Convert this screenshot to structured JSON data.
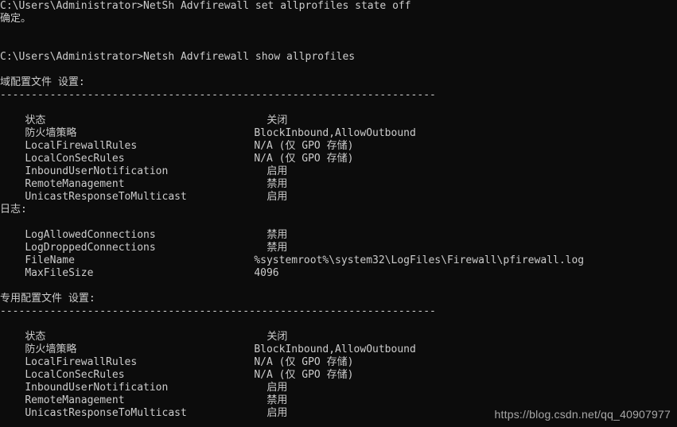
{
  "window": {
    "app": "Command Prompt",
    "background_color": "#0c0c0c",
    "text_color": "#cccccc"
  },
  "terminal": {
    "prompt_1": "C:\\Users\\Administrator>NetSh Advfirewall set allprofiles state off",
    "result_1": "确定。",
    "blank_1": "",
    "blank_2": "",
    "prompt_2": "C:\\Users\\Administrator>Netsh Advfirewall show allprofiles",
    "blank_3": "",
    "sections": [
      {
        "title": "域配置文件 设置:",
        "rule": "----------------------------------------------------------------------",
        "rows": [
          {
            "key": "状态",
            "value": "关闭",
            "cjk": true
          },
          {
            "key": "防火墙策略",
            "value": "BlockInbound,AllowOutbound",
            "cjk": false
          },
          {
            "key": "LocalFirewallRules",
            "value": "N/A (仅 GPO 存储)",
            "cjk": false
          },
          {
            "key": "LocalConSecRules",
            "value": "N/A (仅 GPO 存储)",
            "cjk": false
          },
          {
            "key": "InboundUserNotification",
            "value": "启用",
            "cjk": true
          },
          {
            "key": "RemoteManagement",
            "value": "禁用",
            "cjk": true
          },
          {
            "key": "UnicastResponseToMulticast",
            "value": "启用",
            "cjk": true
          }
        ],
        "sub_title": "日志:",
        "sub_rows": [
          {
            "key": "LogAllowedConnections",
            "value": "禁用",
            "cjk": true
          },
          {
            "key": "LogDroppedConnections",
            "value": "禁用",
            "cjk": true
          },
          {
            "key": "FileName",
            "value": "%systemroot%\\system32\\LogFiles\\Firewall\\pfirewall.log",
            "cjk": false
          },
          {
            "key": "MaxFileSize",
            "value": "4096",
            "cjk": false
          }
        ]
      },
      {
        "title": "专用配置文件 设置:",
        "rule": "----------------------------------------------------------------------",
        "rows": [
          {
            "key": "状态",
            "value": "关闭",
            "cjk": true
          },
          {
            "key": "防火墙策略",
            "value": "BlockInbound,AllowOutbound",
            "cjk": false
          },
          {
            "key": "LocalFirewallRules",
            "value": "N/A (仅 GPO 存储)",
            "cjk": false
          },
          {
            "key": "LocalConSecRules",
            "value": "N/A (仅 GPO 存储)",
            "cjk": false
          },
          {
            "key": "InboundUserNotification",
            "value": "启用",
            "cjk": true
          },
          {
            "key": "RemoteManagement",
            "value": "禁用",
            "cjk": true
          },
          {
            "key": "UnicastResponseToMulticast",
            "value": "启用",
            "cjk": true
          }
        ]
      }
    ]
  },
  "watermark": {
    "text": "https://blog.csdn.net/qq_40907977"
  }
}
